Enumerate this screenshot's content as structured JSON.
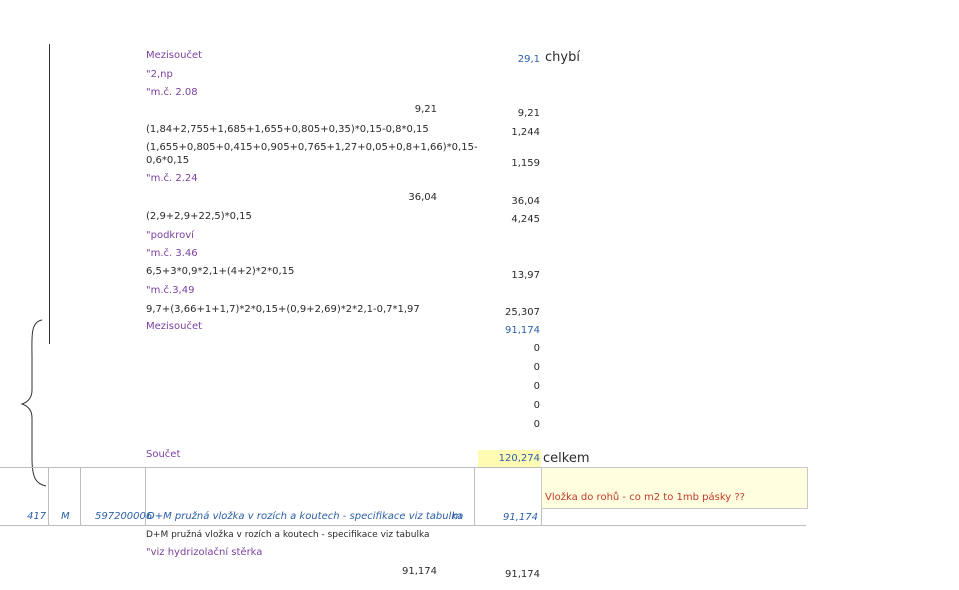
{
  "rows": [
    {
      "label": "Mezisoučet",
      "style": "purple",
      "amount": "",
      "total": "29,1",
      "total_style": "blue",
      "note": "chybí"
    },
    {
      "label": "\"2,np",
      "style": "purple"
    },
    {
      "label": "\"m.č. 2.08",
      "style": "purple"
    },
    {
      "label": "",
      "amount": "9,21",
      "total": "9,21"
    },
    {
      "label": "(1,84+2,755+1,685+1,655+0,805+0,35)*0,15-0,8*0,15",
      "total": "1,244"
    },
    {
      "label": "(1,655+0,805+0,415+0,905+0,765+1,27+0,05+0,8+1,66)*0,15-",
      "label2": "0,6*0,15",
      "total": "1,159"
    },
    {
      "label": "\"m.č. 2.24",
      "style": "purple"
    },
    {
      "label": "",
      "amount": "36,04",
      "total": "36,04"
    },
    {
      "label": "(2,9+2,9+22,5)*0,15",
      "total": "4,245"
    },
    {
      "label": "\"podkroví",
      "style": "purple"
    },
    {
      "label": "\"m.č. 3.46",
      "style": "purple"
    },
    {
      "label": "6,5+3*0,9*2,1+(4+2)*2*0,15",
      "total": "13,97"
    },
    {
      "label": "\"m.č.3,49",
      "style": "purple"
    },
    {
      "label": "9,7+(3,66+1+1,7)*2*0,15+(0,9+2,69)*2*2,1-0,7*1,97",
      "total": "25,307"
    },
    {
      "label": "Mezisoučet",
      "style": "purple",
      "total": "91,174",
      "total_style": "blue"
    }
  ],
  "zeros": [
    "0",
    "0",
    "0",
    "0",
    "0"
  ],
  "soucet": {
    "label": "Součet",
    "total": "120,274",
    "note": "celkem"
  },
  "item": {
    "no": "417",
    "type": "M",
    "code": "597200006",
    "desc": "D+M pružná vložka v rozích a koutech - specifikace viz tabulka",
    "unit": "m",
    "qty": "91,174",
    "comment": "Vložka do rohů - co m2 to 1mb pásky ??"
  },
  "after": {
    "desc": "D+M pružná vložka v rozích a koutech - specifikace viz tabulka",
    "ref": "\"viz hydrizolační stěrka",
    "amount": "91,174",
    "total": "91,174"
  }
}
